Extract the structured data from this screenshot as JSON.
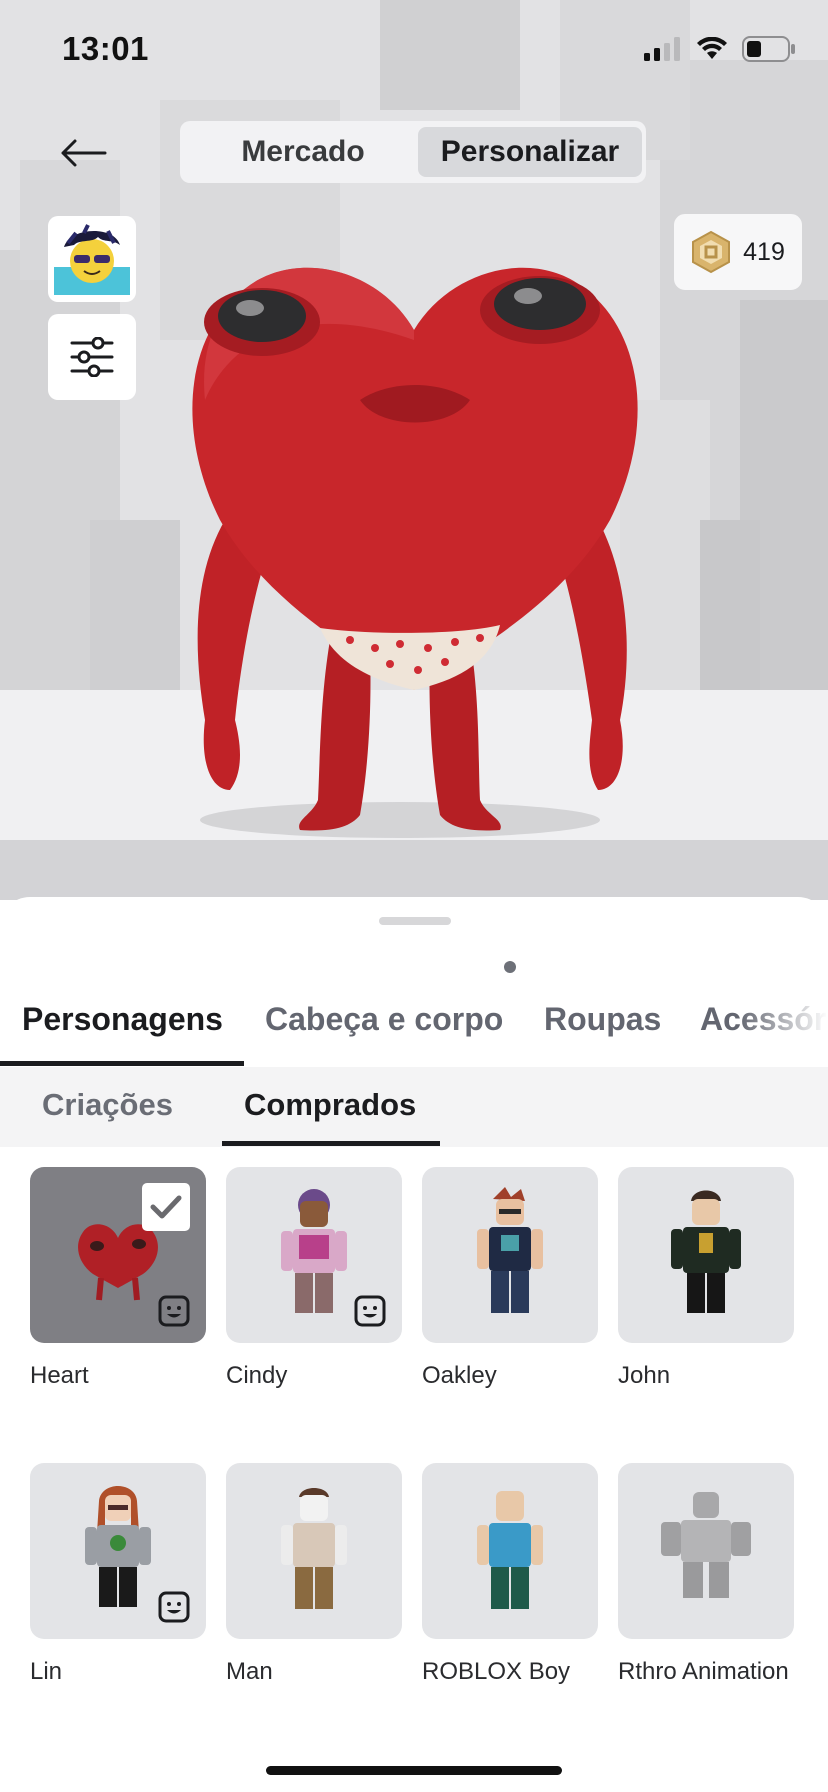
{
  "status_bar": {
    "time": "13:01"
  },
  "nav": {
    "segments": [
      {
        "label": "Mercado",
        "selected": false
      },
      {
        "label": "Personalizar",
        "selected": true
      }
    ]
  },
  "robux": {
    "amount": "419"
  },
  "main_tabs": [
    {
      "label": "Personagens",
      "active": true
    },
    {
      "label": "Cabeça e corpo",
      "active": false
    },
    {
      "label": "Roupas",
      "active": false
    },
    {
      "label": "Acessórios",
      "active": false
    }
  ],
  "sub_tabs": [
    {
      "label": "Criações",
      "active": false
    },
    {
      "label": "Comprados",
      "active": true
    }
  ],
  "items": [
    {
      "name": "Heart",
      "selected": true,
      "has_emote_badge": true,
      "icon": "heart-character-icon"
    },
    {
      "name": "Cindy",
      "selected": false,
      "has_emote_badge": true,
      "icon": "cindy-character-icon"
    },
    {
      "name": "Oakley",
      "selected": false,
      "has_emote_badge": false,
      "icon": "oakley-character-icon"
    },
    {
      "name": "John",
      "selected": false,
      "has_emote_badge": false,
      "icon": "john-character-icon"
    },
    {
      "name": "Lin",
      "selected": false,
      "has_emote_badge": true,
      "icon": "lin-character-icon"
    },
    {
      "name": "Man",
      "selected": false,
      "has_emote_badge": false,
      "icon": "man-character-icon"
    },
    {
      "name": "ROBLOX Boy",
      "selected": false,
      "has_emote_badge": false,
      "icon": "roblox-boy-character-icon"
    },
    {
      "name": "Rthro Animation",
      "selected": false,
      "has_emote_badge": false,
      "icon": "rthro-character-icon"
    }
  ],
  "colors": {
    "accent_dark": "#1b1c1f",
    "heart_red": "#c8262b",
    "tile_bg": "#e3e4e7",
    "tile_selected_bg": "#7f7f84"
  }
}
